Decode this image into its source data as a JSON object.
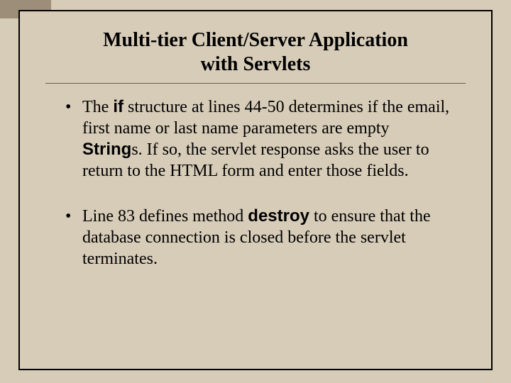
{
  "title_line1": "Multi-tier Client/Server Application",
  "title_line2": "with Servlets",
  "bullet1": {
    "pre": "The ",
    "kw1": "if",
    "mid1": " structure at lines 44-50 determines if the email, first name or last name parameters are empty ",
    "kw2": "String",
    "post": "s. If so, the servlet response asks the user to return to the HTML form and enter those fields."
  },
  "bullet2": {
    "pre": "Line 83 defines method ",
    "kw1": "destroy",
    "post": " to ensure that the database connection is closed before the servlet terminates."
  }
}
